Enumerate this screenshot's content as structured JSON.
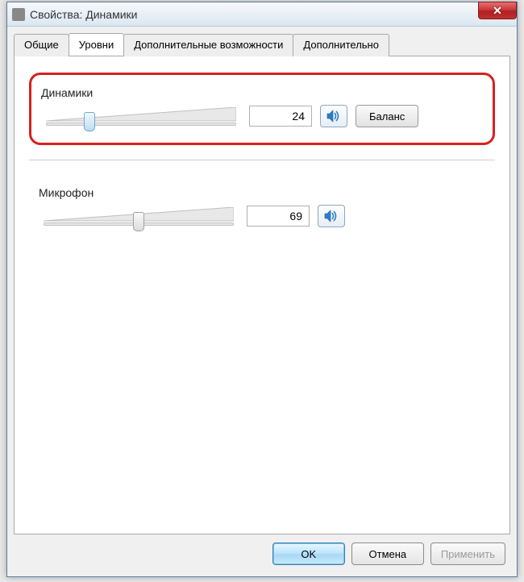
{
  "window": {
    "title": "Свойства: Динамики"
  },
  "tabs": {
    "general": "Общие",
    "levels": "Уровни",
    "enhancements": "Дополнительные возможности",
    "advanced": "Дополнительно"
  },
  "groups": {
    "speakers": {
      "label": "Динамики",
      "value": "24",
      "slider_percent": 24,
      "balance_label": "Баланс"
    },
    "microphone": {
      "label": "Микрофон",
      "value": "69",
      "slider_percent": 50
    }
  },
  "footer": {
    "ok": "OK",
    "cancel": "Отмена",
    "apply": "Применить"
  }
}
